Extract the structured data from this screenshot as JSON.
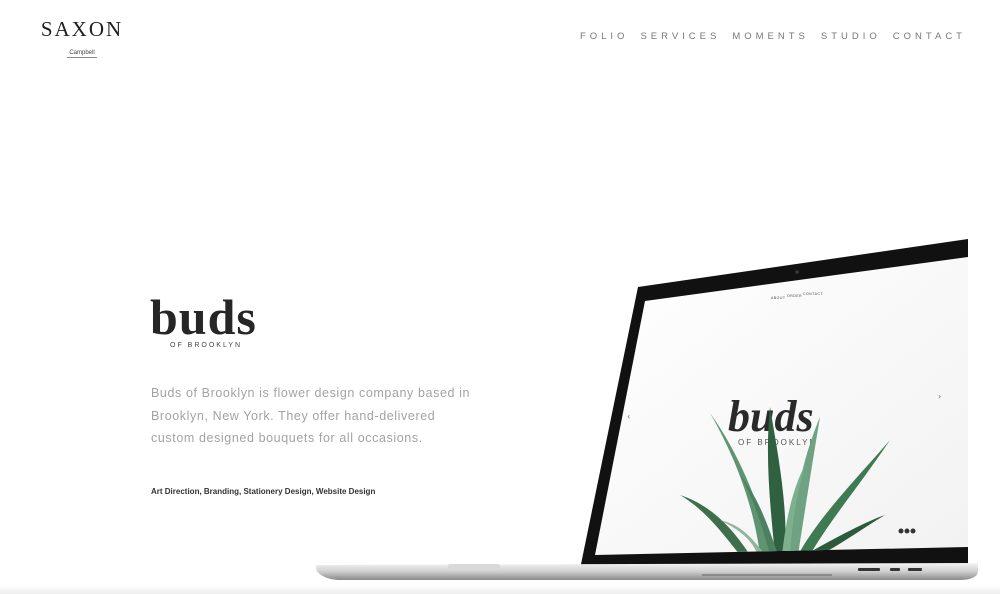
{
  "header": {
    "logo_title": "SAXON",
    "logo_subtitle": "Campbell",
    "nav": [
      "FOLIO",
      "SERVICES",
      "MOMENTS",
      "STUDIO",
      "CONTACT"
    ]
  },
  "project": {
    "name": "buds",
    "tagline": "OF BROOKLYN",
    "description": "Buds of Brooklyn is flower design company based in Brooklyn, New York. They offer hand-delivered custom designed bouquets for all occasions.",
    "services": "Art Direction, Branding, Stationery Design, Website Design"
  },
  "laptop_screen": {
    "nav": [
      "ABOUT",
      "ORDER",
      "CONTACT"
    ],
    "word": "buds",
    "sub": "OF BROOKLYN"
  },
  "colors": {
    "accent_dark": "#222222",
    "text_muted": "#a3a3a3",
    "leaf_green": "#3e7a52"
  }
}
